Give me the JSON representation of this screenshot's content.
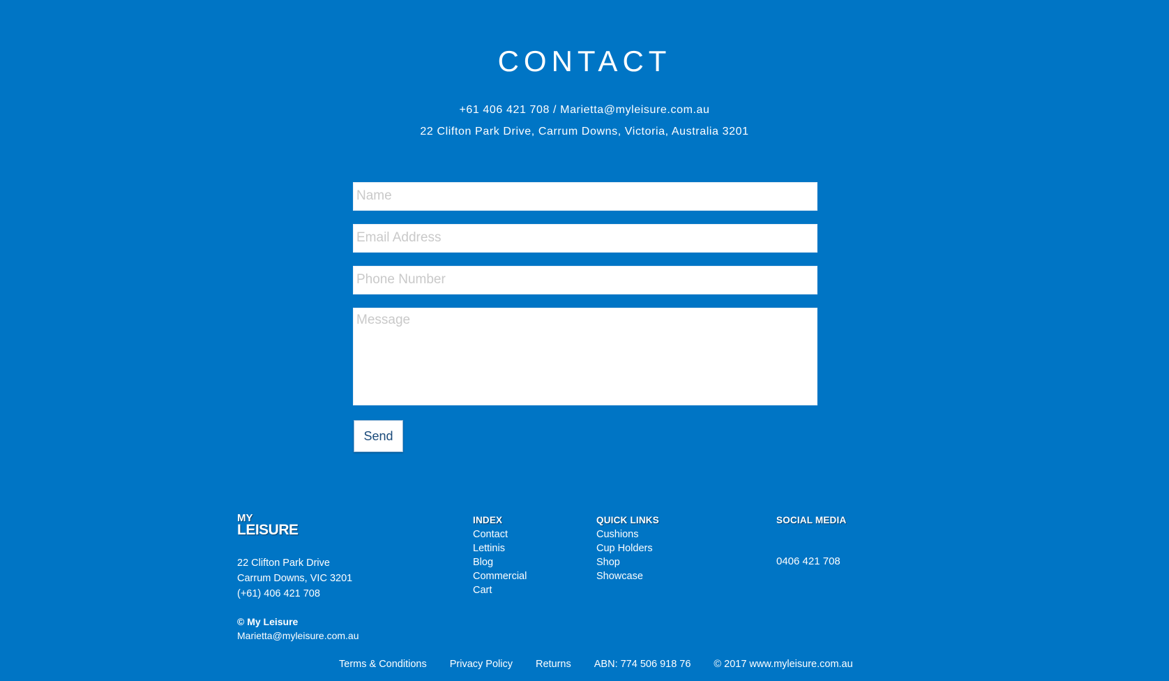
{
  "contact": {
    "title": "CONTACT",
    "line1": "+61 406 421 708 / Marietta@myleisure.com.au",
    "line2": "22 Clifton Park Drive, Carrum Downs, Victoria, Australia 3201"
  },
  "form": {
    "name_placeholder": "Name",
    "email_placeholder": "Email Address",
    "phone_placeholder": "Phone Number",
    "message_placeholder": "Message",
    "send_label": "Send"
  },
  "footer": {
    "brand_line1": "MY",
    "brand_line2": "LEISURE",
    "address_line1": "22 Clifton Park Drive",
    "address_line2": "Carrum Downs, VIC 3201",
    "address_phone": "(+61) 406 421 708",
    "copyright_brand": "© My Leisure",
    "email": "Marietta@myleisure.com.au",
    "index": {
      "heading": "INDEX",
      "items": [
        "Contact",
        "Lettinis",
        "Blog",
        "Commercial",
        "Cart"
      ]
    },
    "quick_links": {
      "heading": "QUICK LINKS",
      "items": [
        "Cushions",
        "Cup Holders",
        "Shop",
        "Showcase"
      ]
    },
    "social": {
      "heading": "SOCIAL MEDIA",
      "phone": "0406 421 708"
    },
    "bottom": {
      "terms": "Terms & Conditions",
      "privacy": "Privacy Policy",
      "returns": "Returns",
      "abn": "ABN: 774 506 918 76",
      "site": "© 2017 www.myleisure.com.au"
    }
  },
  "colors": {
    "background": "#0075c5",
    "text": "#ffffff",
    "button_text": "#1a4a7a"
  }
}
